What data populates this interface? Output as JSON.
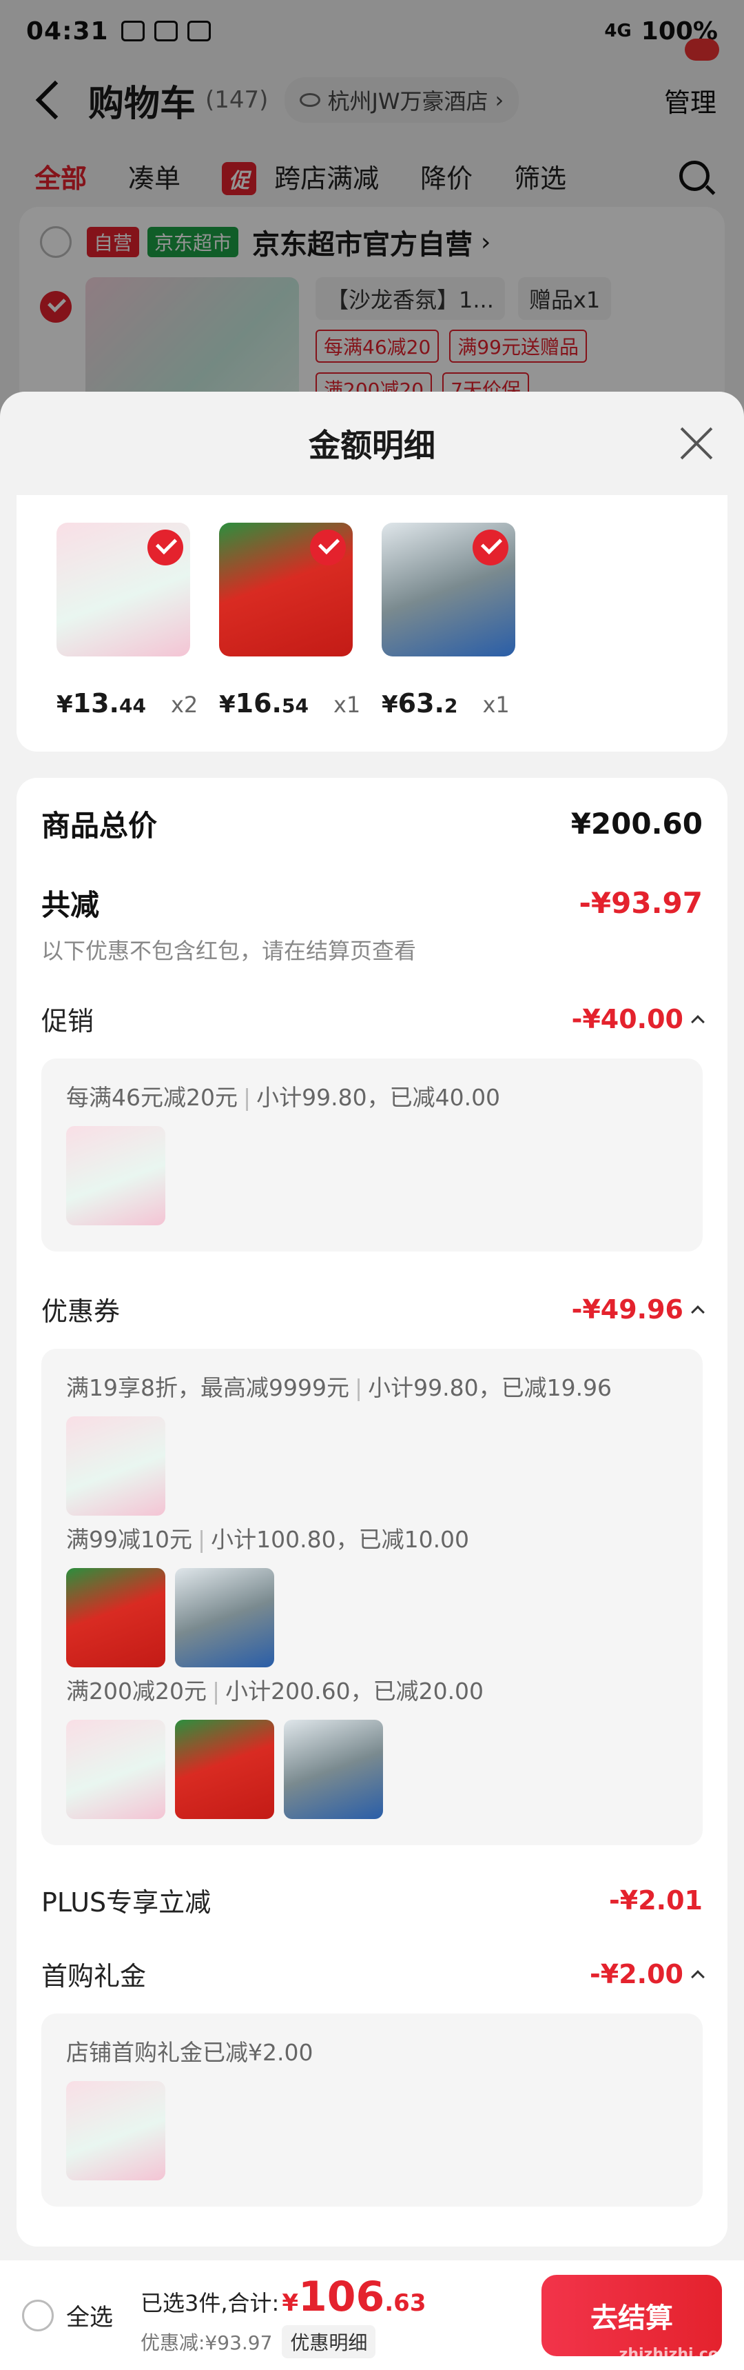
{
  "status_bar": {
    "time": "04:31",
    "network": "4G",
    "battery": "100%"
  },
  "cart_header": {
    "title": "购物车",
    "count": "(147)",
    "location": "杭州JW万豪酒店"
  },
  "manage_label": "管理",
  "filter_tabs": [
    {
      "label": "全部"
    },
    {
      "label": "凑单"
    },
    {
      "label": "跨店满减",
      "tag": "促"
    },
    {
      "label": "降价"
    },
    {
      "label": "筛选"
    }
  ],
  "store": {
    "tag_self": "自营",
    "tag_channel": "京东超市",
    "name": "京东超市官方自营",
    "item_title": "【沙龙香氛】1...",
    "gift": "赠品x1",
    "promos": [
      "每满46减20",
      "满99元送赠品",
      "满200减20",
      "7天价保"
    ]
  },
  "sheet": {
    "title": "金额明细",
    "products": [
      {
        "yen": "¥",
        "int": "13.",
        "dec": "44",
        "qty": "x2"
      },
      {
        "yen": "¥",
        "int": "16.",
        "dec": "54",
        "qty": "x1"
      },
      {
        "yen": "¥",
        "int": "63.",
        "dec": "2",
        "qty": "x1"
      }
    ],
    "total_label": "商品总价",
    "total_value": "¥200.60",
    "discount_label": "共减",
    "discount_value": "-¥93.97",
    "discount_note": "以下优惠不包含红包，请在结算页查看",
    "promo": {
      "label": "促销",
      "value": "-¥40.00",
      "rule": "每满46元减20元",
      "detail": "小计99.80，已减40.00"
    },
    "coupon": {
      "label": "优惠券",
      "value": "-¥49.96",
      "rules": [
        {
          "rule": "满19享8折，最高减9999元",
          "detail": "小计99.80，已减19.96"
        },
        {
          "rule": "满99减10元",
          "detail": "小计100.80，已减10.00"
        },
        {
          "rule": "满200减20元",
          "detail": "小计200.60，已减20.00"
        }
      ]
    },
    "plus": {
      "label": "PLUS专享立减",
      "value": "-¥2.01"
    },
    "first_gift": {
      "label": "首购礼金",
      "value": "-¥2.00",
      "note": "店铺首购礼金已减¥2.00"
    }
  },
  "checkout": {
    "select_all": "全选",
    "selected_prefix": "已选3件,合计:",
    "yen": "¥",
    "total_int": "106",
    "total_dec": ".63",
    "discount_text": "优惠减:¥93.97",
    "discount_btn": "优惠明细",
    "checkout_btn": "去结算",
    "watermark": "zhizhizhi.com"
  },
  "colors": {
    "accent": "#e4222d",
    "green": "#1ca046"
  }
}
